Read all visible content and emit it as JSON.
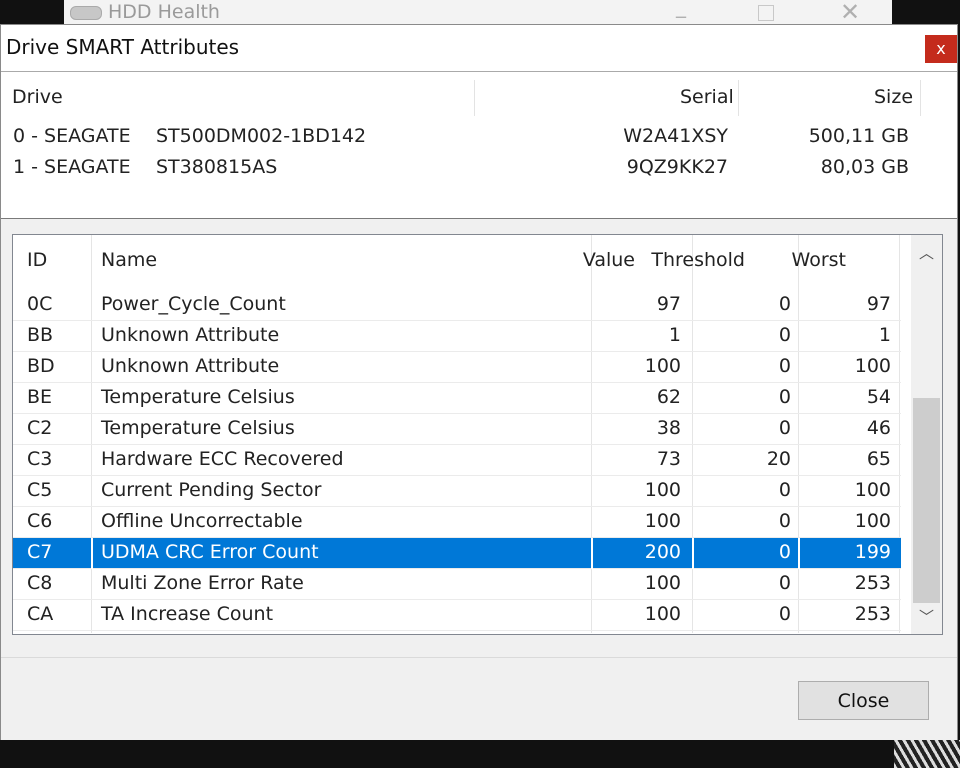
{
  "background_window": {
    "title": "HDD Health",
    "icon": "hdd-icon"
  },
  "dialog": {
    "title": "Drive SMART Attributes",
    "close_glyph": "x",
    "close_button_color": "#c42b1c"
  },
  "drives": {
    "headers": {
      "drive": "Drive",
      "serial": "Serial",
      "size": "Size"
    },
    "rows": [
      {
        "index": "0 - SEAGATE",
        "model": "ST500DM002-1BD142",
        "serial": "W2A41XSY",
        "size": "500,11 GB"
      },
      {
        "index": "1 - SEAGATE",
        "model": "ST380815AS",
        "serial": "9QZ9KK27",
        "size": "80,03 GB"
      }
    ]
  },
  "attributes": {
    "headers": {
      "id": "ID",
      "name": "Name",
      "value": "Value",
      "threshold": "Threshold",
      "worst": "Worst"
    },
    "selected_color": "#0078d7",
    "rows": [
      {
        "id": "0C",
        "name": "Power_Cycle_Count",
        "value": "97",
        "threshold": "0",
        "worst": "97"
      },
      {
        "id": "BB",
        "name": "Unknown Attribute",
        "value": "1",
        "threshold": "0",
        "worst": "1"
      },
      {
        "id": "BD",
        "name": "Unknown Attribute",
        "value": "100",
        "threshold": "0",
        "worst": "100"
      },
      {
        "id": "BE",
        "name": "Temperature Celsius",
        "value": "62",
        "threshold": "0",
        "worst": "54"
      },
      {
        "id": "C2",
        "name": "Temperature Celsius",
        "value": "38",
        "threshold": "0",
        "worst": "46"
      },
      {
        "id": "C3",
        "name": "Hardware ECC Recovered",
        "value": "73",
        "threshold": "20",
        "worst": "65"
      },
      {
        "id": "C5",
        "name": "Current Pending Sector",
        "value": "100",
        "threshold": "0",
        "worst": "100"
      },
      {
        "id": "C6",
        "name": "Offline Uncorrectable",
        "value": "100",
        "threshold": "0",
        "worst": "100"
      },
      {
        "id": "C7",
        "name": "UDMA CRC Error Count",
        "value": "200",
        "threshold": "0",
        "worst": "199",
        "selected": true
      },
      {
        "id": "C8",
        "name": "Multi Zone Error Rate",
        "value": "100",
        "threshold": "0",
        "worst": "253"
      },
      {
        "id": "CA",
        "name": "TA Increase Count",
        "value": "100",
        "threshold": "0",
        "worst": "253"
      }
    ]
  },
  "scrollbar": {
    "up_icon": "chevron-up-icon",
    "down_icon": "chevron-down-icon"
  },
  "footer": {
    "close_label": "Close"
  }
}
